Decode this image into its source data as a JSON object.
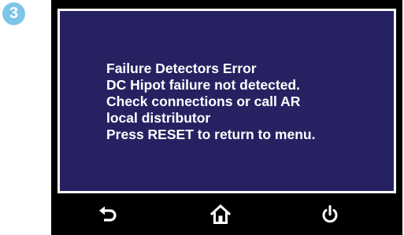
{
  "step": {
    "number": "3",
    "color": "#7cc6e8"
  },
  "screen": {
    "background": "#262262",
    "border": "#ffffff",
    "message_lines": [
      "Failure Detectors Error",
      "DC Hipot failure not detected.",
      "Check connections or call AR",
      "local distributor",
      "Press RESET to return to menu."
    ]
  },
  "toolbar": {
    "buttons": [
      {
        "icon": "back-arrow-icon"
      },
      {
        "icon": "home-icon"
      },
      {
        "icon": "power-icon"
      }
    ]
  }
}
